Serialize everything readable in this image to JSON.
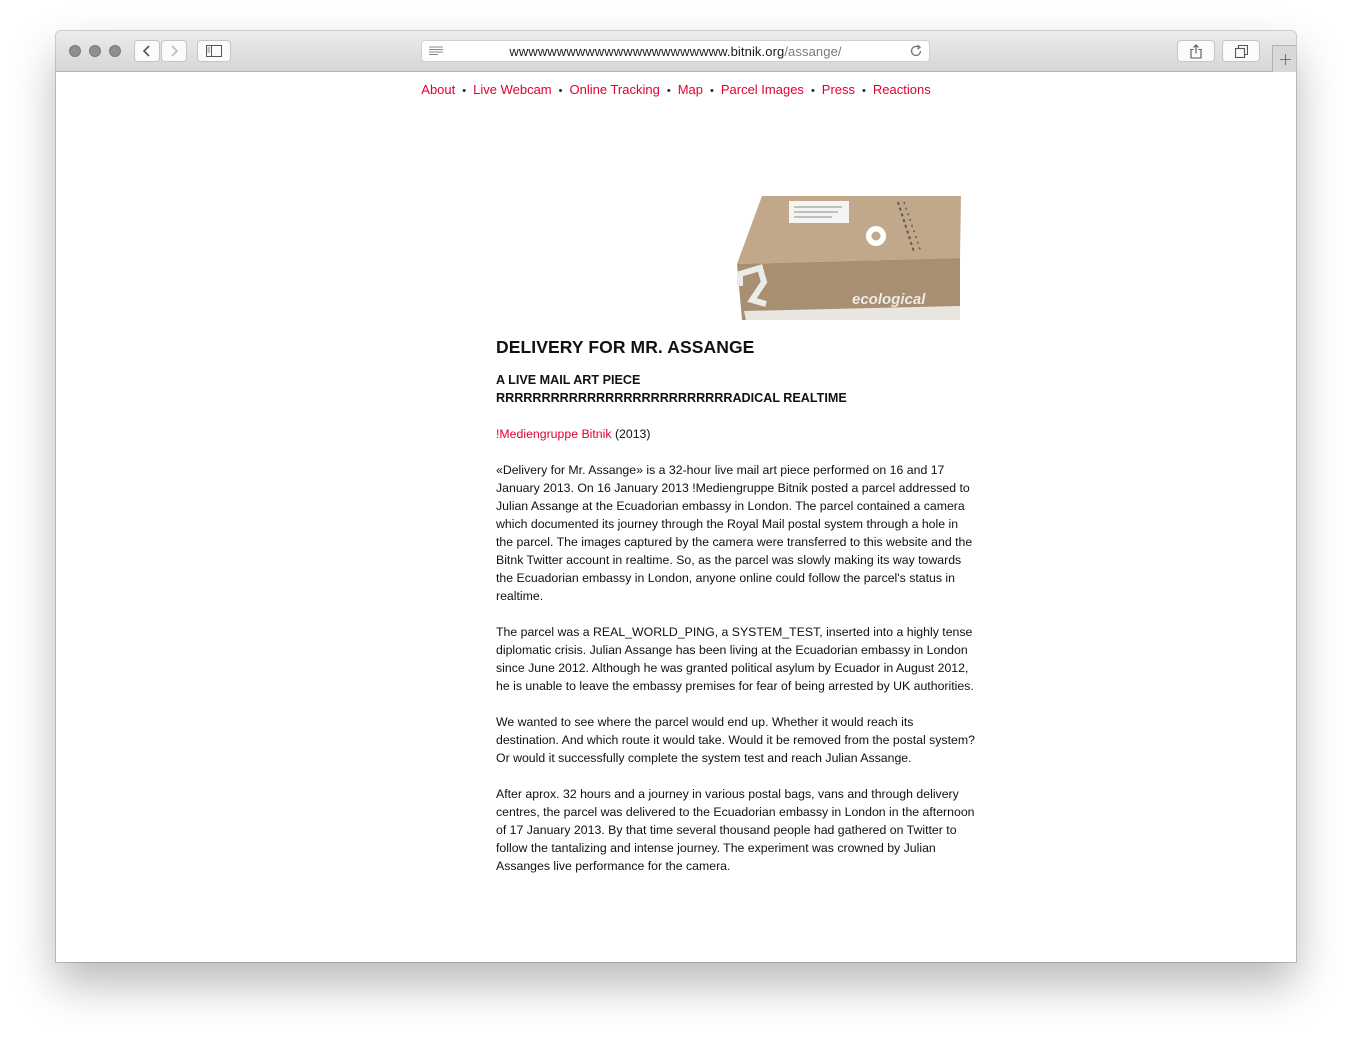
{
  "browser": {
    "url_main": "wwwwwwwwwwwwwwwwwwwwwww.bitnik.org",
    "url_path": "/assange/"
  },
  "nav": {
    "items": [
      "About",
      "Live Webcam",
      "Online Tracking",
      "Map",
      "Parcel Images",
      "Press",
      "Reactions"
    ],
    "separator": "•"
  },
  "hero_image": {
    "box_number": "2",
    "box_label": "ecological"
  },
  "article": {
    "title": "DELIVERY FOR MR. ASSANGE",
    "subtitle_line1": "A LIVE MAIL ART PIECE",
    "subtitle_line2": "RRRRRRRRRRRRRRRRRRRRRRRRRRADICAL REALTIME",
    "author_link": "!Mediengruppe Bitnik",
    "year": " (2013)",
    "paragraphs": [
      "«Delivery for Mr. Assange» is a 32-hour live mail art piece performed on 16 and 17 January 2013. On 16 January 2013 !Mediengruppe Bitnik posted a parcel addressed to Julian Assange at the Ecuadorian embassy in London. The parcel contained a camera which documented its journey through the Royal Mail postal system through a hole in the parcel. The images captured by the camera were transferred to this website and the Bitnk Twitter account in realtime. So, as the parcel was slowly making its way towards the Ecuadorian embassy in London, anyone online could follow the parcel's status in realtime.",
      "The parcel was a REAL_WORLD_PING, a SYSTEM_TEST, inserted into a highly tense diplomatic crisis. Julian Assange has been living at the Ecuadorian embassy in London since June 2012. Although he was granted political asylum by Ecuador in August 2012, he is unable to leave the embassy premises for fear of being arrested by UK authorities.",
      "We wanted to see where the parcel would end up. Whether it would reach its destination. And which route it would take. Would it be removed from the postal system? Or would it successfully complete the system test and reach Julian Assange.",
      "After aprox. 32 hours and a journey in various postal bags, vans and through delivery centres, the parcel was delivered to the Ecuadorian embassy in London in the afternoon of 17 January 2013. By that time several thousand people had gathered on Twitter to follow the tantalizing and intense journey. The experiment was crowned by Julian Assanges live performance for the camera."
    ]
  },
  "colors": {
    "link": "#e2002d",
    "text": "#111111",
    "cardboard": "#b49a7c"
  }
}
